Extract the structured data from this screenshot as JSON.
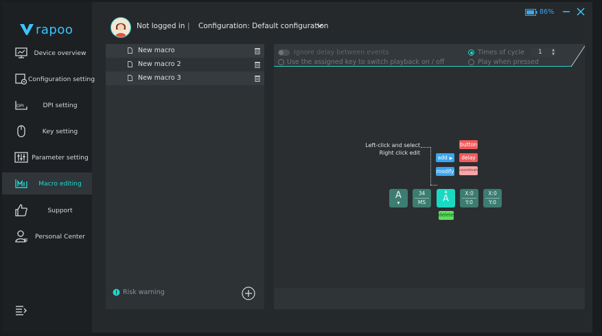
{
  "app": {
    "brand": "rapoo",
    "brand_color": "#39c6ff",
    "accent": "#20d8cc"
  },
  "header": {
    "user_status": "Not logged in",
    "separator": "|",
    "configuration": "Configuration: Default configuration",
    "battery": "86%"
  },
  "sidebar": {
    "items": [
      {
        "label": "Device overview",
        "icon": "monitor-icon"
      },
      {
        "label": "Configuration setting",
        "icon": "config-settings-icon"
      },
      {
        "label": "DPI setting",
        "icon": "dpi-icon"
      },
      {
        "label": "Key setting",
        "icon": "mouse-icon"
      },
      {
        "label": "Parameter setting",
        "icon": "sliders-icon"
      },
      {
        "label": "Macro editing",
        "icon": "macro-icon",
        "active": true
      },
      {
        "label": "Support",
        "icon": "thumbs-up-icon"
      },
      {
        "label": "Personal Center",
        "icon": "person-icon"
      }
    ]
  },
  "macros": {
    "items": [
      {
        "name": "New macro"
      },
      {
        "name": "New macro 2"
      },
      {
        "name": "New macro 3"
      }
    ],
    "risk_warning": "Risk warning"
  },
  "editor": {
    "ignore_delay": "Ignore delay between events",
    "assigned_key": "Use the assigned key to switch playback on / off",
    "times_of_cycle": "Times of cycle",
    "cycle_value": "1",
    "play_when_pressed": "Play when pressed",
    "annotation_line1": "Left-click and select",
    "annotation_line2": "Right click edit",
    "buttons": {
      "add": "add",
      "modify": "modify",
      "button": "button",
      "delay": "delay",
      "coordinate": "coordinate",
      "delete": "delete"
    },
    "events": [
      {
        "type": "key",
        "label": "A",
        "direction": "down"
      },
      {
        "type": "delay",
        "line1": "34",
        "line2": "MS"
      },
      {
        "type": "key",
        "label": "A",
        "direction": "up",
        "selected": true
      },
      {
        "type": "coord",
        "line1": "X:0",
        "line2": "Y:0"
      },
      {
        "type": "coord",
        "line1": "X:0",
        "line2": "Y:0"
      }
    ]
  }
}
